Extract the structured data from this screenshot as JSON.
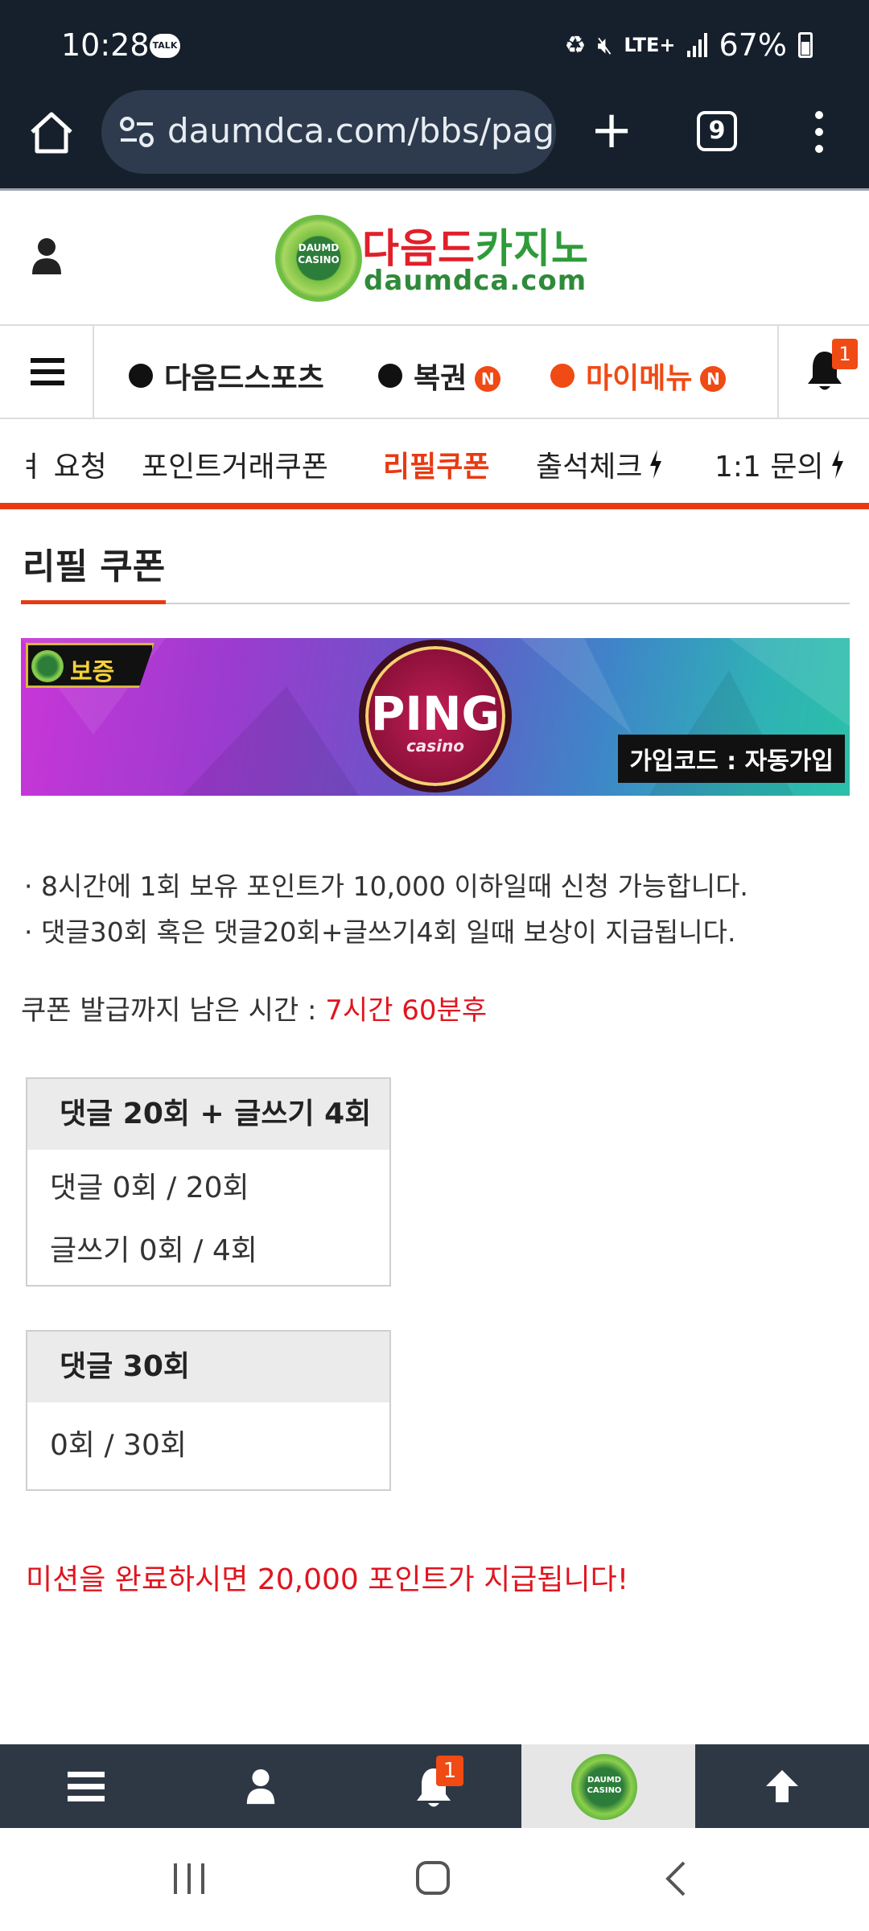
{
  "status_bar": {
    "time": "10:28",
    "talk_badge": "TALK",
    "network": "LTE+",
    "battery": "67%"
  },
  "browser": {
    "url": "daumdca.com/bbs/pag",
    "tab_count": "9"
  },
  "site_header": {
    "logo_kr_part1": "다음드",
    "logo_kr_part2": "카지노",
    "logo_en": "daumdca.com",
    "logo_badge": "DAUMD CASINO"
  },
  "main_nav": {
    "items": [
      {
        "label": "다음드스포츠",
        "badge": ""
      },
      {
        "label": "복권",
        "badge": "N"
      },
      {
        "label": "마이메뉴",
        "badge": "N"
      }
    ],
    "notification_count": "1"
  },
  "sub_nav": {
    "items": [
      {
        "label": "ㅕ 요청"
      },
      {
        "label": "포인트거래쿠폰"
      },
      {
        "label": "리필쿠폰"
      },
      {
        "label": "출석체크"
      },
      {
        "label": "1:1 문의"
      }
    ]
  },
  "page": {
    "title": "리필 쿠폰",
    "banner": {
      "badge": "보증",
      "brand": "PING",
      "brand_sub": "casino",
      "join_code": "가입코드 : 자동가입"
    },
    "info_lines": [
      "· 8시간에 1회 보유 포인트가 10,000 이하일때 신청 가능합니다.",
      "· 댓글30회 혹은 댓글20회+글쓰기4회 일때 보상이 지급됩니다."
    ],
    "remaining_label": "쿠폰 발급까지 남은 시간 : ",
    "remaining_value": "7시간 60분후",
    "mission1": {
      "header": "댓글 20회 + 글쓰기 4회",
      "rows": [
        "댓글 0회 / 20회",
        "글쓰기 0회 / 4회"
      ]
    },
    "mission2": {
      "header": "댓글 30회",
      "rows": [
        "0회 / 30회"
      ]
    },
    "complete_message": "미션을 완료하시면 20,000 포인트가 지급됩니다!"
  },
  "bottom_bar": {
    "notification_count": "1",
    "logo_text": "DAUMD CASINO"
  },
  "colors": {
    "accent": "#e83a12",
    "highlight_red": "#e0151f",
    "dark_bar": "#16202c",
    "bottom_bar": "#2e3845"
  }
}
